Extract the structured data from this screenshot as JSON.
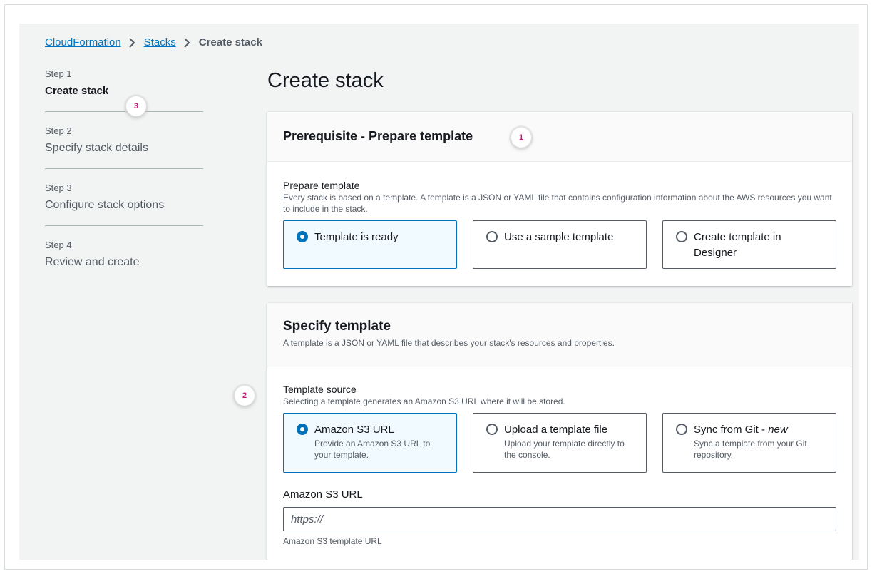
{
  "breadcrumb": {
    "items": [
      "CloudFormation",
      "Stacks"
    ],
    "current": "Create stack"
  },
  "steps": [
    {
      "num": "Step 1",
      "title": "Create stack"
    },
    {
      "num": "Step 2",
      "title": "Specify stack details"
    },
    {
      "num": "Step 3",
      "title": "Configure stack options"
    },
    {
      "num": "Step 4",
      "title": "Review and create"
    }
  ],
  "page": {
    "title": "Create stack"
  },
  "badges": [
    "1",
    "2",
    "3"
  ],
  "prerequisite": {
    "title": "Prerequisite - Prepare template",
    "label": "Prepare template",
    "description": "Every stack is based on a template. A template is a JSON or YAML file that contains configuration information about the AWS resources you want to include in the stack.",
    "options": [
      {
        "label": "Template is ready",
        "selected": true
      },
      {
        "label": "Use a sample template",
        "selected": false
      },
      {
        "label": "Create template in Designer",
        "selected": false
      }
    ]
  },
  "specify": {
    "title": "Specify template",
    "subtitle": "A template is a JSON or YAML file that describes your stack's resources and properties.",
    "source_label": "Template source",
    "source_desc": "Selecting a template generates an Amazon S3 URL where it will be stored.",
    "options": [
      {
        "label": "Amazon S3 URL",
        "desc": "Provide an Amazon S3 URL to your template.",
        "selected": true
      },
      {
        "label": "Upload a template file",
        "desc": "Upload your template directly to the console.",
        "selected": false
      },
      {
        "label": "Sync from Git - ",
        "label_suffix": "new",
        "desc": "Sync a template from your Git repository.",
        "selected": false
      }
    ],
    "url_label": "Amazon S3 URL",
    "url_placeholder": "https://",
    "url_hint": "Amazon S3 template URL"
  },
  "colors": {
    "accent": "#0073bb",
    "badge_text": "#c7137e",
    "background": "#f2f3f3"
  }
}
